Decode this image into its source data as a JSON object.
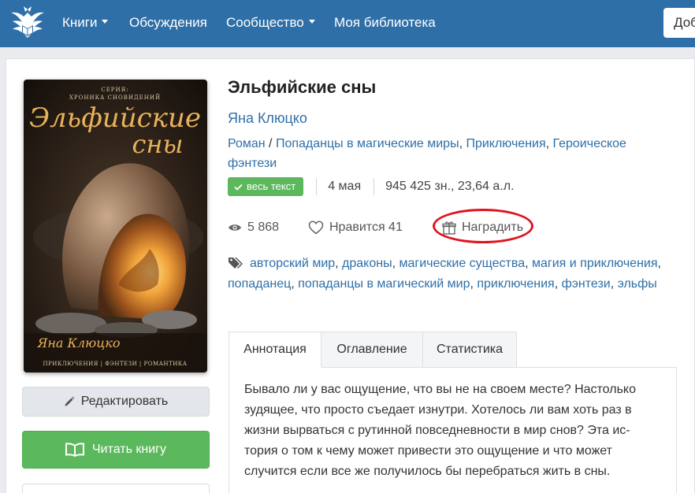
{
  "nav": {
    "items": [
      "Книги",
      "Обсуждения",
      "Сообщество",
      "Моя библиотека"
    ],
    "button_label": "Доб"
  },
  "cover": {
    "series_line1": "СЕРИЯ:",
    "series_line2": "ХРОНИКА СНОВИДЕНИЙ",
    "title_line1": "Эльфийские",
    "title_line2": "сны",
    "author": "Яна Клюцко",
    "genres": "ПРИКЛЮЧЕНИЯ | ФЭНТЕЗИ | РОМАНТИКА"
  },
  "buttons": {
    "edit_label": "Редактировать",
    "read_label": "Читать книгу"
  },
  "book": {
    "title": "Эльфийские сны",
    "author": "Яна Клюцко",
    "genre_type": "Роман",
    "genre_sep": " / ",
    "genres": [
      "Попаданцы в магические миры",
      "Приключения",
      "Героическое фэнтези"
    ],
    "status_badge": "весь текст",
    "date": "4 мая",
    "size": "945 425 зн., 23,64 а.л."
  },
  "stats": {
    "views": "5 868",
    "likes_label": "Нравится 41",
    "reward_label": "Наградить"
  },
  "tags": [
    "авторский мир",
    "драконы",
    "магические существа",
    "магия и приключения",
    "попаданец",
    "попаданцы в магический мир",
    "приключения",
    "фэнтези",
    "эльфы"
  ],
  "tabs": [
    "Аннотация",
    "Оглавление",
    "Статистика"
  ],
  "annotation": "Бывало ли у вас ощущение, что вы не на своем месте? Настолько зудящее, что просто съедает изнутри. Хотелось ли вам хоть раз в жизни вырваться с рутинной повседневности в мир снов? Эта ис-тория о том к чему может привести это ощущение и что может случится если все же получилось бы перебраться жить в сны.",
  "colors": {
    "navbar": "#2f6fa7",
    "link": "#2f6fa7",
    "success": "#5cb85c",
    "highlight": "#e0141e"
  }
}
